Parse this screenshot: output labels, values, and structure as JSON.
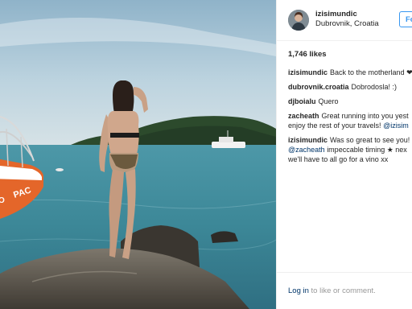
{
  "header": {
    "username": "izisimundic",
    "location": "Dubrovnik, Croatia",
    "follow_label": "Fo"
  },
  "likes": "1,746 likes",
  "comments": [
    {
      "user": "izisimundic",
      "text": "Back to the motherland ❤"
    },
    {
      "user": "dubrovnik.croatia",
      "text": "Dobrodosla! :)"
    },
    {
      "user": "djboialu",
      "text": "Quero"
    },
    {
      "user": "zacheath",
      "line1": "Great running into you yest",
      "line2": "enjoy the rest of your travels!",
      "mention": "@izisim"
    },
    {
      "user": "izisimundic",
      "line1": "Was so great to see you!",
      "mention": "@zacheath",
      "line2": "impeccable timing ★ nex",
      "line3": "we'll have to all go for a vino xx"
    }
  ],
  "footer": {
    "login_label": "Log in",
    "login_suffix": "to like or comment."
  },
  "photo": {
    "boat_name": "PAC",
    "boat_prefix": "O"
  },
  "colors": {
    "accent": "#3897f0",
    "link": "#003569",
    "sea": "#3f8a9a",
    "sky": "#b9d0dc",
    "boat": "#e4662a"
  }
}
